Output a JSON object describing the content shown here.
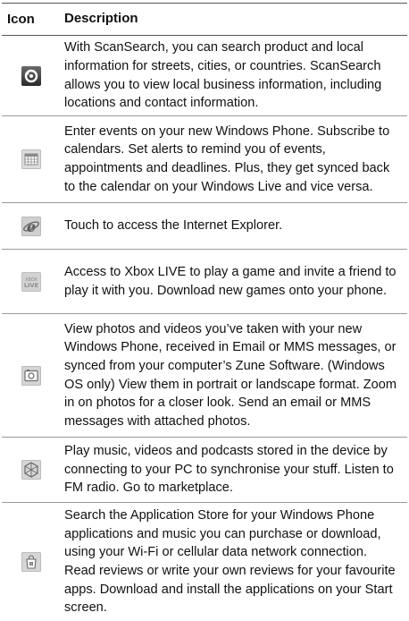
{
  "header": {
    "icon": "Icon",
    "description": "Description"
  },
  "rows": [
    {
      "icon": "scansearch-icon",
      "text": "With ScanSearch, you can search product and local information for streets, cities, or countries. ScanSearch allows you to view local business information, including locations and contact information."
    },
    {
      "icon": "calendar-icon",
      "text": "Enter events on your new Windows Phone. Subscribe to calendars. Set alerts to remind you of events, appointments and deadlines. Plus, they get synced back to the calendar on your Windows Live and vice versa."
    },
    {
      "icon": "internet-explorer-icon",
      "text": "Touch to access the Internet Explorer."
    },
    {
      "icon": "xbox-live-icon",
      "label": "XBOX LIVE",
      "text": "Access to Xbox LIVE to play a game and invite a friend to play it with you. Download new games onto your phone."
    },
    {
      "icon": "pictures-icon",
      "text": "View photos and videos you’ve taken with your new Windows Phone, received in Email or MMS messages, or synced from your computer’s Zune Software. (Windows OS only) View them in portrait or landscape format. Zoom in on photos for a closer look. Send an email or MMS messages with attached photos."
    },
    {
      "icon": "music-videos-icon",
      "text": "Play music, videos and podcasts stored in the device by connecting to your PC to synchronise your stuff. Listen to FM radio. Go to marketplace."
    },
    {
      "icon": "marketplace-icon",
      "text": "Search the Application Store for your Windows Phone applications and music you can purchase or download, using your Wi-Fi or cellular data network connection. Read reviews or write your own reviews for your favourite apps. Download and install the applications on your Start screen."
    }
  ]
}
